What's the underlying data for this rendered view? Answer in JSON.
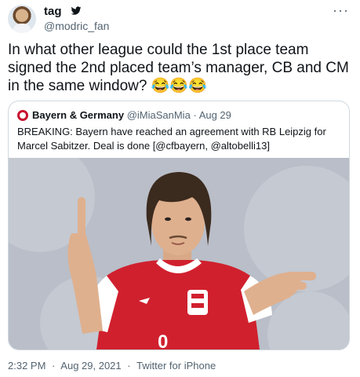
{
  "author": {
    "name": "tag",
    "handle": "@modric_fan"
  },
  "tweet": {
    "text": "In what other league could the 1st place team signed the 2nd placed team’s manager, CB and CM in the same window? 😂😂😂"
  },
  "quoted": {
    "name": "Bayern & Germany",
    "handle": "@iMiaSanMia",
    "separator": "·",
    "date": "Aug 29",
    "text": "BREAKING: Bayern have reached an agreement with RB Leipzig for Marcel Sabitzer. Deal is done [@cfbayern, @altobelli13]",
    "media_description_icon": "player-photo"
  },
  "meta": {
    "time": "2:32 PM",
    "dot1": "·",
    "date": "Aug 29, 2021",
    "dot2": "·",
    "source": "Twitter for iPhone"
  },
  "icons": {
    "verified": "bird-icon",
    "more": "more-icon"
  },
  "colors": {
    "text": "#0f1419",
    "secondary": "#536471",
    "border": "#cfd9de",
    "jersey_red": "#d0202e"
  }
}
